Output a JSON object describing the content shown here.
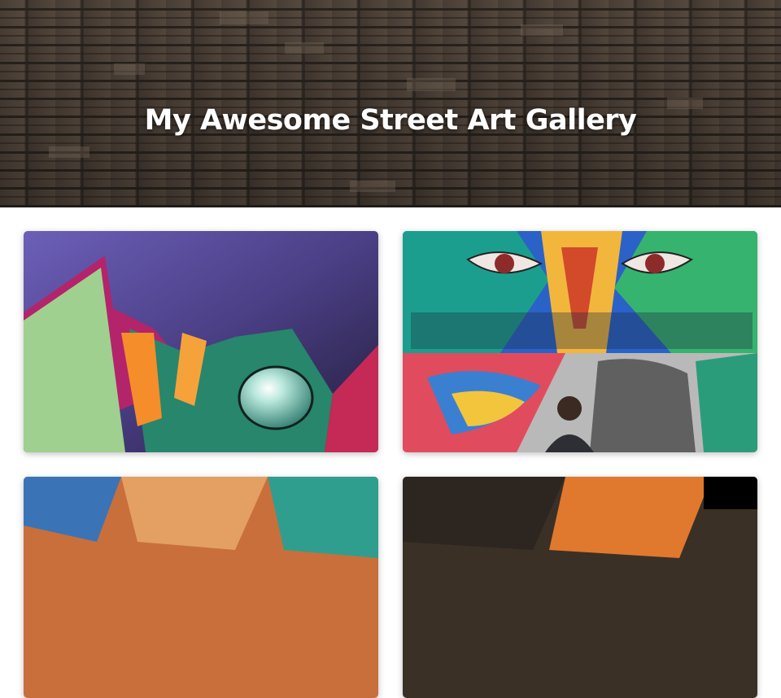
{
  "header": {
    "title": "My Awesome Street Art Gallery"
  },
  "gallery": {
    "items": [
      {
        "icon": "graffiti-purple-art-image"
      },
      {
        "icon": "graffiti-eyes-mural-image"
      },
      {
        "icon": "graffiti-orange-art-image"
      },
      {
        "icon": "graffiti-dark-orange-art-image"
      }
    ]
  }
}
